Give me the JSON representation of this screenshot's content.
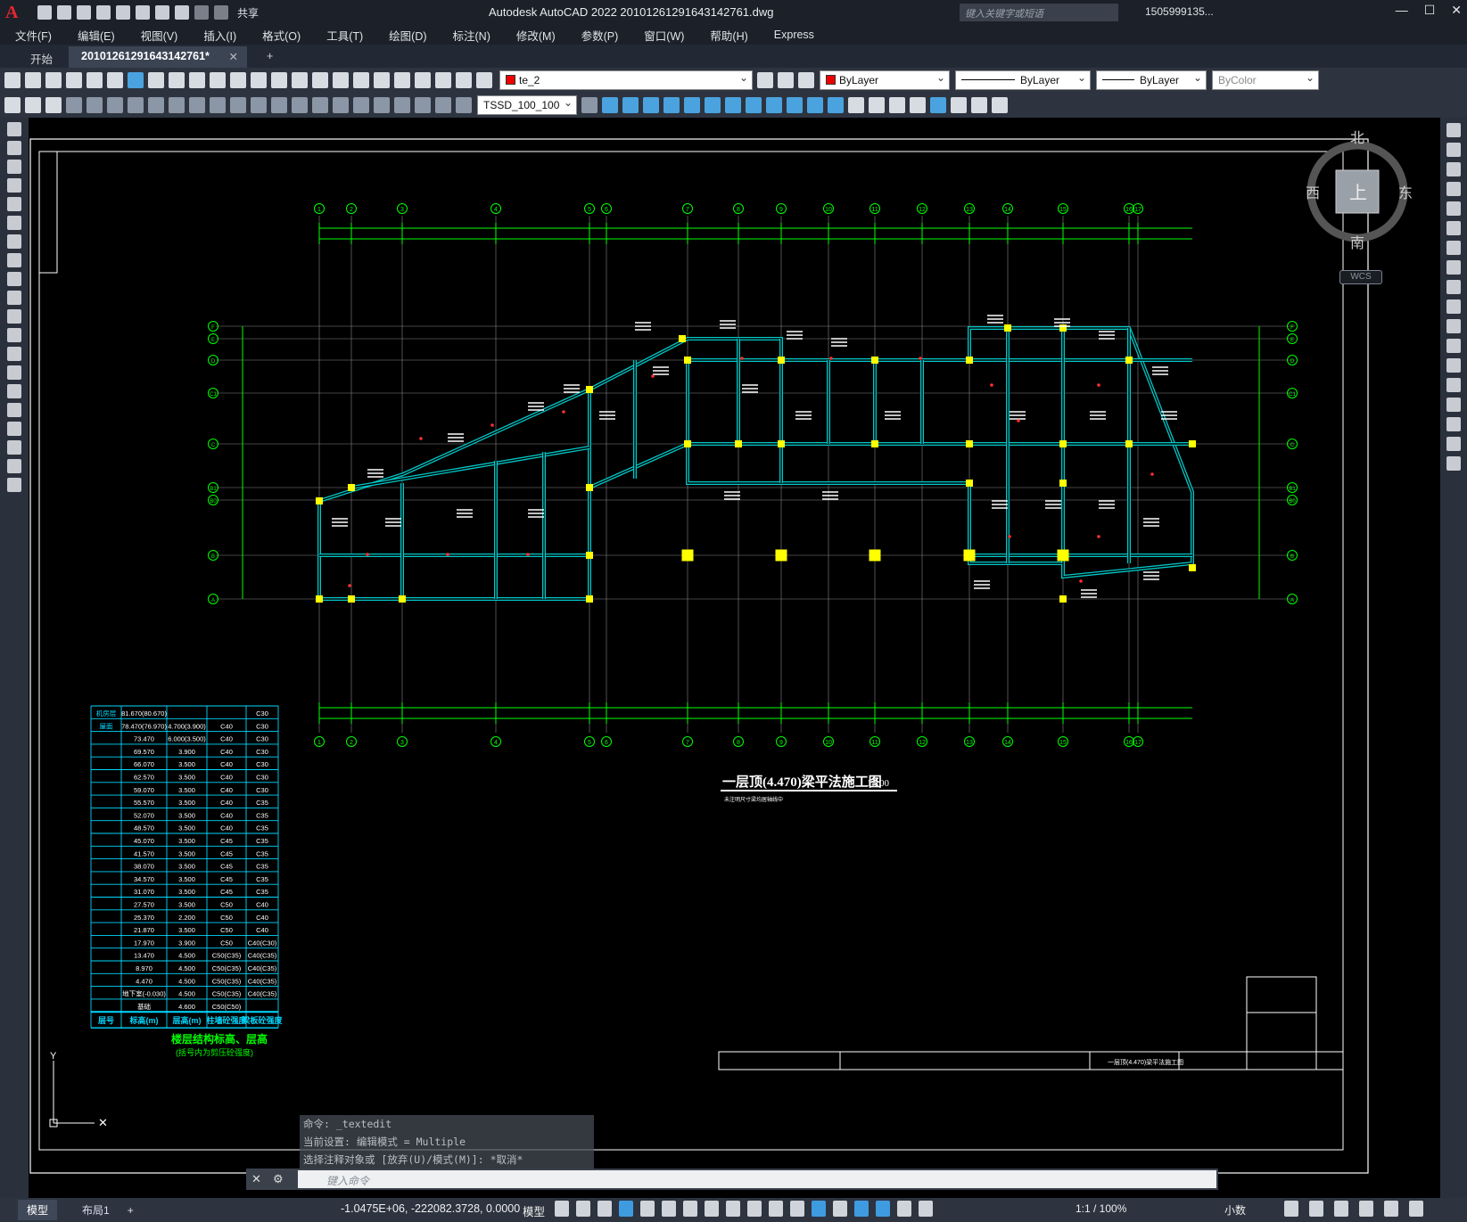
{
  "titlebar": {
    "app_logo": "A",
    "share_label": "共享",
    "title": "Autodesk AutoCAD 2022    20101261291643142761.dwg",
    "search_placeholder": "键入关键字或短语",
    "user": "1505999135...",
    "controls": [
      "—",
      "☐",
      "✕"
    ]
  },
  "menu": [
    "文件(F)",
    "编辑(E)",
    "视图(V)",
    "插入(I)",
    "格式(O)",
    "工具(T)",
    "绘图(D)",
    "标注(N)",
    "修改(M)",
    "参数(P)",
    "窗口(W)",
    "帮助(H)",
    "Express"
  ],
  "tabs": {
    "start": "开始",
    "active": "20101261291643142761*",
    "close": "✕",
    "new": "+"
  },
  "toolbar": {
    "layer": "te_2",
    "color": "ByLayer",
    "linetype": "ByLayer",
    "lineweight": "ByLayer",
    "plotstyle": "ByColor",
    "dimstyle": "TSSD_100_100",
    "layer_color": "#e00000"
  },
  "viewcube": {
    "north": "北",
    "south": "南",
    "west": "西",
    "east": "东",
    "face": "上",
    "wcs": "WCS"
  },
  "drawing": {
    "plan_title": "一层顶(4.470)梁平法施工图",
    "scale_label": "1:100",
    "plan_note": "未注明尺寸梁均居轴线中",
    "grid_top": [
      "1",
      "2",
      "3",
      "4",
      "5",
      "6",
      "7",
      "8",
      "9",
      "10",
      "11",
      "12",
      "13",
      "14",
      "15",
      "16",
      "17"
    ],
    "grid_side": [
      "F",
      "E",
      "D",
      "C1",
      "C",
      "B1",
      "B0",
      "B",
      "A"
    ],
    "floor_table": {
      "header": [
        "层号",
        "标高(m)",
        "层高(m)",
        "柱墙砼强度",
        "梁板砼强度"
      ],
      "title": "楼层结构标高、层高",
      "subtitle": "(括号内为剪压砼强度)",
      "rows": [
        [
          "机房层",
          "81.670(80.670)",
          "",
          "",
          "C30"
        ],
        [
          "屋面",
          "78.470(76.970)",
          "4.700(3.900)",
          "C40",
          "C30"
        ],
        [
          "",
          "73.470",
          "6.000(3.500)",
          "C40",
          "C30"
        ],
        [
          "",
          "69.570",
          "3.900",
          "C40",
          "C30"
        ],
        [
          "",
          "66.070",
          "3.500",
          "C40",
          "C30"
        ],
        [
          "",
          "62.570",
          "3.500",
          "C40",
          "C30"
        ],
        [
          "",
          "59.070",
          "3.500",
          "C40",
          "C30"
        ],
        [
          "",
          "55.570",
          "3.500",
          "C40",
          "C35"
        ],
        [
          "",
          "52.070",
          "3.500",
          "C40",
          "C35"
        ],
        [
          "",
          "48.570",
          "3.500",
          "C40",
          "C35"
        ],
        [
          "",
          "45.070",
          "3.500",
          "C45",
          "C35"
        ],
        [
          "",
          "41.570",
          "3.500",
          "C45",
          "C35"
        ],
        [
          "",
          "38.070",
          "3.500",
          "C45",
          "C35"
        ],
        [
          "",
          "34.570",
          "3.500",
          "C45",
          "C35"
        ],
        [
          "",
          "31.070",
          "3.500",
          "C45",
          "C35"
        ],
        [
          "",
          "27.570",
          "3.500",
          "C50",
          "C40"
        ],
        [
          "",
          "25.370",
          "2.200",
          "C50",
          "C40"
        ],
        [
          "",
          "21.870",
          "3.500",
          "C50",
          "C40"
        ],
        [
          "",
          "17.970",
          "3.900",
          "C50",
          "C40(C30)"
        ],
        [
          "",
          "13.470",
          "4.500",
          "C50(C35)",
          "C40(C35)"
        ],
        [
          "",
          "8.970",
          "4.500",
          "C50(C35)",
          "C40(C35)"
        ],
        [
          "",
          "4.470",
          "4.500",
          "C50(C35)",
          "C40(C35)"
        ],
        [
          "",
          "地下室(-0.030)",
          "4.500",
          "C50(C35)",
          "C40(C35)"
        ],
        [
          "",
          "基础",
          "4.600",
          "C50(C50)",
          ""
        ]
      ]
    },
    "title_block_text": "一层顶(4.470)梁平法施工图"
  },
  "command": {
    "history": [
      "命令: _textedit",
      "当前设置: 编辑模式 = Multiple",
      "选择注释对象或 [放弃(U)/模式(M)]: *取消*"
    ],
    "placeholder": "键入命令"
  },
  "status": {
    "tabs": [
      "模型",
      "布局1",
      "+"
    ],
    "coords": "-1.0475E+06, -222082.3728, 0.0000",
    "space": "模型",
    "scale": "1:1 / 100%",
    "units": "小数"
  },
  "colors": {
    "canvas": "#000000",
    "grid": "#00ff00",
    "beam": "#00c8c8",
    "column": "#ffff00",
    "text": "#ffffff"
  }
}
